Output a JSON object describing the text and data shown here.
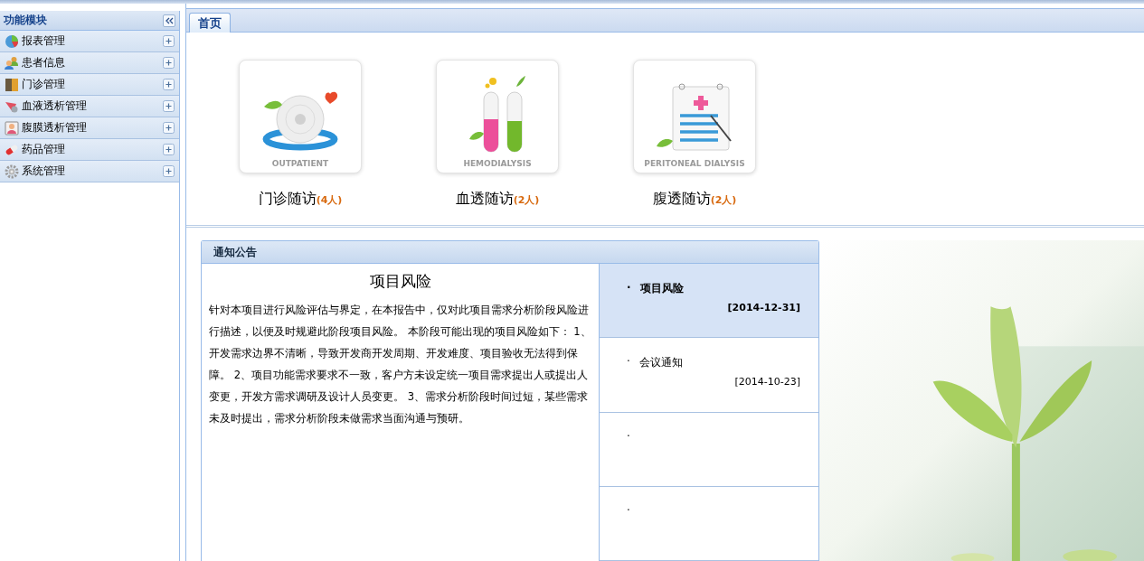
{
  "sidebar": {
    "title": "功能模块",
    "items": [
      {
        "label": "报表管理",
        "kind": "chart"
      },
      {
        "label": "患者信息",
        "kind": "people"
      },
      {
        "label": "门诊管理",
        "kind": "door"
      },
      {
        "label": "血液透析管理",
        "kind": "blood"
      },
      {
        "label": "腹膜透析管理",
        "kind": "patient"
      },
      {
        "label": "药品管理",
        "kind": "pill"
      },
      {
        "label": "系统管理",
        "kind": "gear"
      }
    ]
  },
  "tabs": [
    {
      "label": "首页",
      "selected": true
    }
  ],
  "cards": [
    {
      "kind": "outpatient",
      "caption": "OUTPATIENT",
      "title": "门诊随访",
      "count": "(4人)"
    },
    {
      "kind": "hemodialysis",
      "caption": "HEMODIALYSIS",
      "title": "血透随访",
      "count": "(2人)"
    },
    {
      "kind": "peritoneal",
      "caption": "PERITONEAL DIALYSIS",
      "title": "腹透随访",
      "count": "(2人)"
    }
  ],
  "notice": {
    "title": "通知公告",
    "article": {
      "heading": "项目风险",
      "body": "针对本项目进行风险评估与界定，在本报告中，仅对此项目需求分析阶段风险进行描述，以便及时规避此阶段项目风险。 本阶段可能出现的项目风险如下： 1、开发需求边界不清晰，导致开发商开发周期、开发难度、项目验收无法得到保障。 2、项目功能需求要求不一致，客户方未设定统一项目需求提出人或提出人变更，开发方需求调研及设计人员变更。 3、需求分析阶段时间过短，某些需求未及时提出，需求分析阶段未做需求当面沟通与预研。"
    },
    "items": [
      {
        "bullet": "·",
        "title": "项目风险",
        "date": "[2014-12-31]",
        "selected": true
      },
      {
        "bullet": "·",
        "title": "会议通知",
        "date": "[2014-10-23]",
        "selected": false
      },
      {
        "bullet": "·",
        "selected": false
      },
      {
        "bullet": "·",
        "selected": false
      }
    ]
  }
}
